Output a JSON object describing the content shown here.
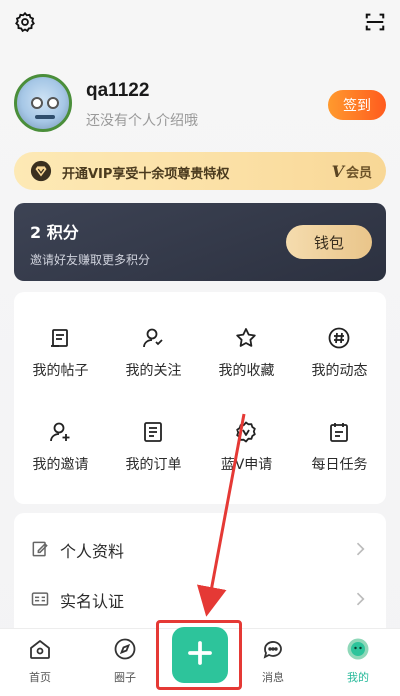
{
  "topbar": {
    "settings_icon": "gear-icon",
    "scan_icon": "scan-icon"
  },
  "profile": {
    "username": "qa1122",
    "bio": "还没有个人介绍哦",
    "signin_label": "签到"
  },
  "vip": {
    "text": "开通VIP享受十余项尊贵特权",
    "badge_v": "V",
    "badge_label": "会员"
  },
  "points": {
    "count": "2 积分",
    "invite": "邀请好友赚取更多积分",
    "wallet_label": "钱包"
  },
  "grid": [
    {
      "label": "我的帖子",
      "icon": "post-icon"
    },
    {
      "label": "我的关注",
      "icon": "follow-icon"
    },
    {
      "label": "我的收藏",
      "icon": "star-icon"
    },
    {
      "label": "我的动态",
      "icon": "hashtag-icon"
    },
    {
      "label": "我的邀请",
      "icon": "invite-icon"
    },
    {
      "label": "我的订单",
      "icon": "order-icon"
    },
    {
      "label": "蓝V申请",
      "icon": "badge-icon"
    },
    {
      "label": "每日任务",
      "icon": "calendar-icon"
    }
  ],
  "list": [
    {
      "label": "个人资料",
      "icon": "edit-profile-icon"
    },
    {
      "label": "实名认证",
      "icon": "id-card-icon"
    }
  ],
  "tabs": [
    {
      "label": "首页",
      "icon": "home-icon"
    },
    {
      "label": "圈子",
      "icon": "compass-icon"
    },
    {
      "label": "消息",
      "icon": "message-icon"
    },
    {
      "label": "我的",
      "icon": "profile-icon"
    }
  ],
  "colors": {
    "accent": "#2dc49b",
    "signin": "#ff6a25",
    "annotation": "#e53935"
  }
}
